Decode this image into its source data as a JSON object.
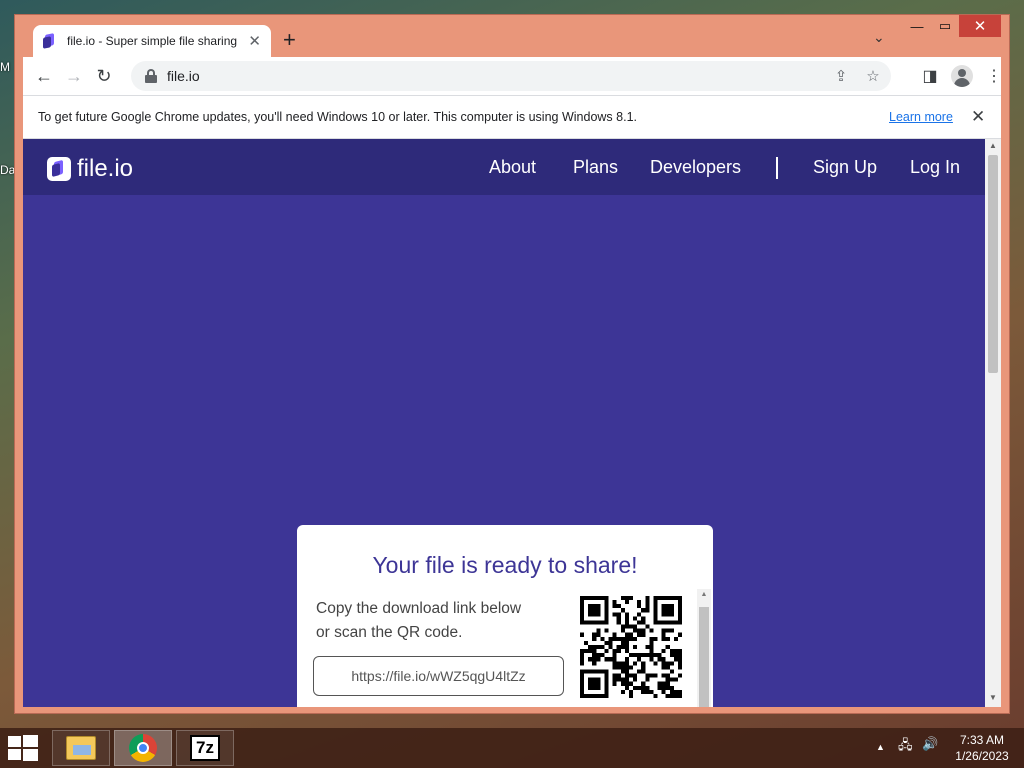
{
  "desktop": {
    "label_1": "M",
    "label_2": "Da"
  },
  "browser": {
    "tab_title": "file.io - Super simple file sharing",
    "new_tab": "+",
    "url": "file.io",
    "infobar_message": "To get future Google Chrome updates, you'll need Windows 10 or later. This computer is using Windows 8.1.",
    "infobar_link": "Learn more"
  },
  "site": {
    "logo_text": "file.io",
    "nav": [
      "About",
      "Plans",
      "Developers",
      "Sign Up",
      "Log In"
    ],
    "brand_color": "#3d3596",
    "nav_color": "#2e2a7a"
  },
  "card": {
    "heading": "Your file is ready to share!",
    "line1": "Copy the download link below",
    "line2": "or scan the QR code.",
    "link": "https://file.io/wWZ5qgU4ltZz"
  },
  "taskbar": {
    "apps": [
      "file-explorer",
      "google-chrome",
      "7-zip"
    ],
    "active_app": "google-chrome",
    "time": "7:33 AM",
    "date": "1/26/2023"
  }
}
